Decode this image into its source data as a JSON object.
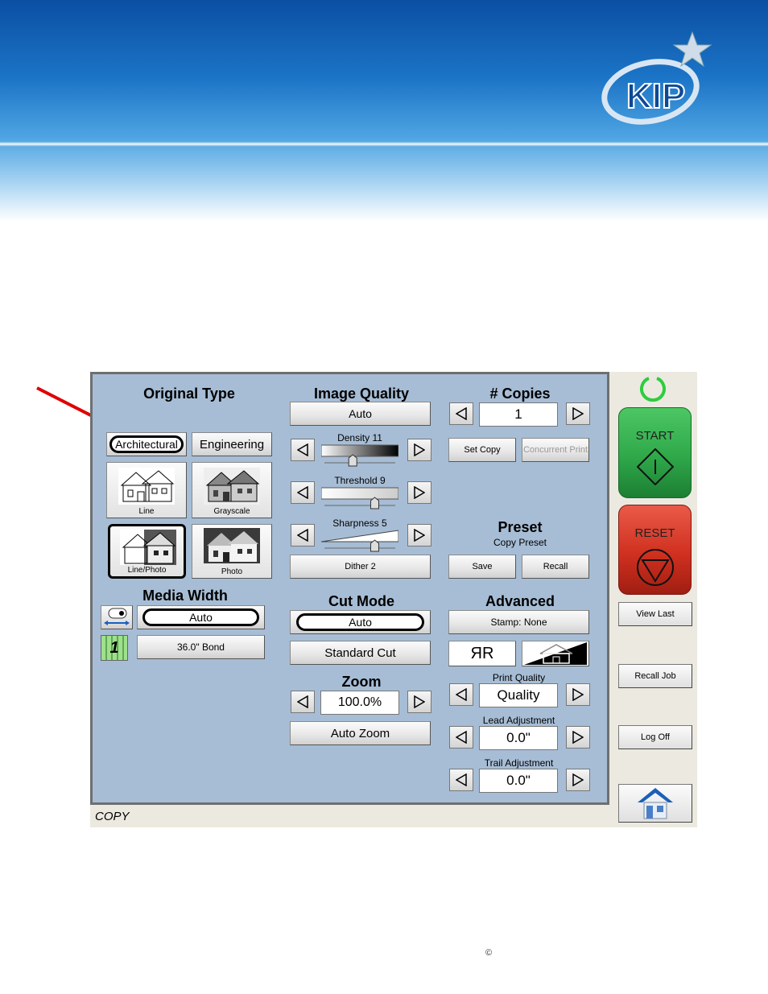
{
  "colors": {
    "panel": "#a7bdd5",
    "start": "#2fa84a",
    "reset": "#d83a2a",
    "status_ring": "#2ecc40"
  },
  "logo": {
    "text": "KIP"
  },
  "original_type": {
    "title": "Original Type",
    "architectural": "Architectural",
    "engineering": "Engineering",
    "line": "Line",
    "grayscale": "Grayscale",
    "line_photo": "Line/Photo",
    "photo": "Photo"
  },
  "image_quality": {
    "title": "Image Quality",
    "mode": "Auto",
    "density_label": "Density 11",
    "density": 0.4,
    "threshold_label": "Threshold 9",
    "threshold": 0.71,
    "sharpness_label": "Sharpness 5",
    "sharpness": 0.71,
    "dither": "Dither 2"
  },
  "copies": {
    "title": "# Copies",
    "value": "1",
    "set_copy": "Set Copy",
    "concurrent_print": "Concurrent Print"
  },
  "preset": {
    "title": "Preset",
    "subtitle": "Copy Preset",
    "save": "Save",
    "recall": "Recall"
  },
  "media_width": {
    "title": "Media Width",
    "value": "Auto",
    "roll_number": "1",
    "media": "36.0\" Bond"
  },
  "cut_mode": {
    "title": "Cut Mode",
    "value": "Auto",
    "standard": "Standard Cut"
  },
  "zoom": {
    "title": "Zoom",
    "value": "100.0%",
    "auto": "Auto Zoom"
  },
  "advanced": {
    "title": "Advanced",
    "stamp": "Stamp: None",
    "mirror": "ЯR",
    "print_quality_label": "Print Quality",
    "print_quality": "Quality",
    "lead_label": "Lead Adjustment",
    "lead": "0.0\"",
    "trail_label": "Trail Adjustment",
    "trail": "0.0\""
  },
  "side": {
    "start": "START",
    "reset": "RESET",
    "view_last": "View Last",
    "recall_job": "Recall Job",
    "log_off": "Log Off"
  },
  "status": "COPY",
  "copyright": "©"
}
